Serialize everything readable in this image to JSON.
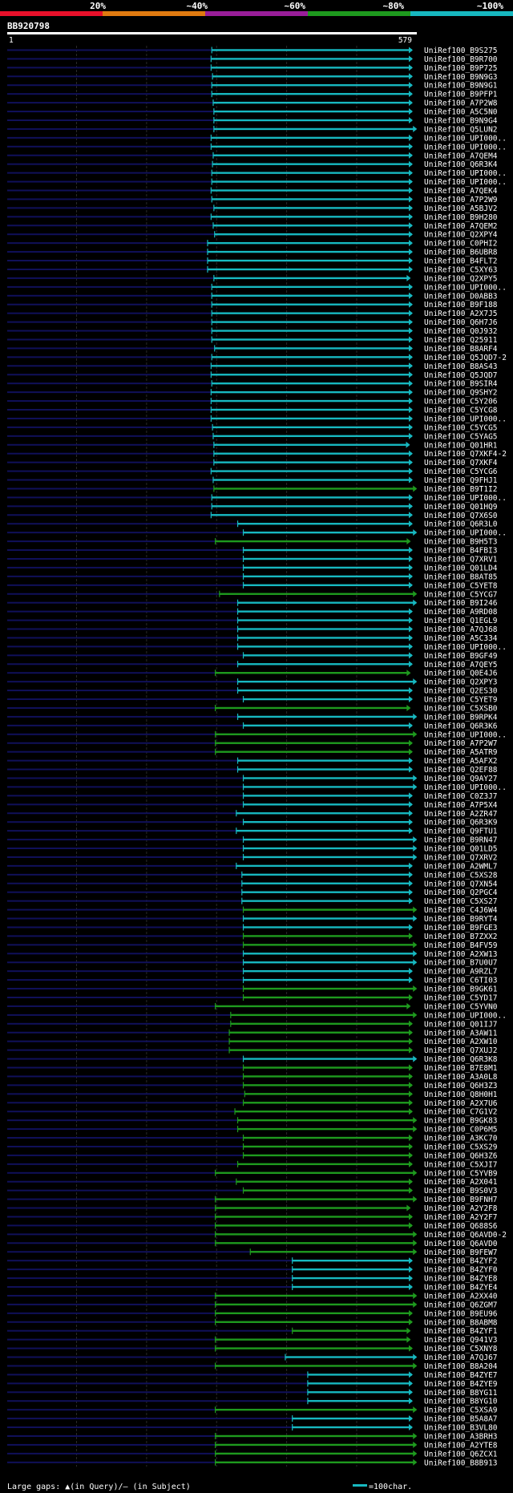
{
  "query_id": "BB920798",
  "identity_legend": [
    {
      "label": "20%",
      "color": "#e8102a"
    },
    {
      "label": "~40%",
      "color": "#e07a10"
    },
    {
      "label": "~60%",
      "color": "#9a1e9a"
    },
    {
      "label": "~80%",
      "color": "#1e9a1e"
    },
    {
      "label": "~100%",
      "color": "#17b8c0"
    }
  ],
  "footer": {
    "gaps_text": "Large gaps: ▲(in Query)/— (in Subject)",
    "scale_text": "=100char."
  },
  "chart_data": {
    "type": "bar",
    "subtype": "blast-alignment-overview",
    "axis": {
      "start": "1",
      "end": "579",
      "min": 1,
      "max": 579
    },
    "grid": true,
    "hits": [
      {
        "name": "UniRef100_B9S275",
        "start": 293,
        "end": 579,
        "identity": 100
      },
      {
        "name": "UniRef100_B9R700",
        "start": 292,
        "end": 579,
        "identity": 100
      },
      {
        "name": "UniRef100_B9P725",
        "start": 292,
        "end": 579,
        "identity": 100
      },
      {
        "name": "UniRef100_B9N9G3",
        "start": 294,
        "end": 579,
        "identity": 100
      },
      {
        "name": "UniRef100_B9N9G1",
        "start": 293,
        "end": 579,
        "identity": 100
      },
      {
        "name": "UniRef100_B9PFP1",
        "start": 293,
        "end": 579,
        "identity": 100
      },
      {
        "name": "UniRef100_A7P2W8",
        "start": 295,
        "end": 579,
        "identity": 100
      },
      {
        "name": "UniRef100_A5C5N0",
        "start": 296,
        "end": 579,
        "identity": 100
      },
      {
        "name": "UniRef100_B9N9G4",
        "start": 296,
        "end": 579,
        "identity": 100
      },
      {
        "name": "UniRef100_Q5LUN2",
        "start": 296,
        "end": 585,
        "identity": 100
      },
      {
        "name": "UniRef100_UPI000..",
        "start": 292,
        "end": 579,
        "identity": 100
      },
      {
        "name": "UniRef100_UPI000..",
        "start": 292,
        "end": 579,
        "identity": 100
      },
      {
        "name": "UniRef100_A7QEM4",
        "start": 295,
        "end": 579,
        "identity": 100
      },
      {
        "name": "UniRef100_Q6R3K4",
        "start": 294,
        "end": 579,
        "identity": 100
      },
      {
        "name": "UniRef100_UPI000..",
        "start": 293,
        "end": 579,
        "identity": 100
      },
      {
        "name": "UniRef100_UPI000..",
        "start": 293,
        "end": 579,
        "identity": 100
      },
      {
        "name": "UniRef100_A7QEK4",
        "start": 292,
        "end": 579,
        "identity": 100
      },
      {
        "name": "UniRef100_A7P2W9",
        "start": 293,
        "end": 579,
        "identity": 100
      },
      {
        "name": "UniRef100_A5BJV2",
        "start": 296,
        "end": 579,
        "identity": 100
      },
      {
        "name": "UniRef100_B9H280",
        "start": 292,
        "end": 579,
        "identity": 100
      },
      {
        "name": "UniRef100_A7QEM2",
        "start": 295,
        "end": 579,
        "identity": 100
      },
      {
        "name": "UniRef100_Q2XPY4",
        "start": 297,
        "end": 579,
        "identity": 100
      },
      {
        "name": "UniRef100_C0PHI2",
        "start": 287,
        "end": 579,
        "identity": 100
      },
      {
        "name": "UniRef100_B6UBR8",
        "start": 287,
        "end": 579,
        "identity": 100
      },
      {
        "name": "UniRef100_B4FLT2",
        "start": 287,
        "end": 579,
        "identity": 100
      },
      {
        "name": "UniRef100_C5XY63",
        "start": 287,
        "end": 579,
        "identity": 100
      },
      {
        "name": "UniRef100_Q2XPY5",
        "start": 296,
        "end": 576,
        "identity": 100
      },
      {
        "name": "UniRef100_UPI000..",
        "start": 293,
        "end": 579,
        "identity": 100
      },
      {
        "name": "UniRef100_D0ABB3",
        "start": 293,
        "end": 579,
        "identity": 100
      },
      {
        "name": "UniRef100_B9F188",
        "start": 293,
        "end": 579,
        "identity": 100
      },
      {
        "name": "UniRef100_A2X7J5",
        "start": 293,
        "end": 579,
        "identity": 100
      },
      {
        "name": "UniRef100_Q6H7J6",
        "start": 293,
        "end": 579,
        "identity": 100
      },
      {
        "name": "UniRef100_Q0J932",
        "start": 293,
        "end": 579,
        "identity": 100
      },
      {
        "name": "UniRef100_Q25911",
        "start": 293,
        "end": 579,
        "identity": 100
      },
      {
        "name": "UniRef100_B8ARF4",
        "start": 297,
        "end": 579,
        "identity": 100
      },
      {
        "name": "UniRef100_Q5JQD7-2",
        "start": 293,
        "end": 579,
        "identity": 100
      },
      {
        "name": "UniRef100_B8AS43",
        "start": 292,
        "end": 579,
        "identity": 100
      },
      {
        "name": "UniRef100_Q5JQD7",
        "start": 292,
        "end": 579,
        "identity": 100
      },
      {
        "name": "UniRef100_B9SIR4",
        "start": 293,
        "end": 579,
        "identity": 100
      },
      {
        "name": "UniRef100_Q9SHY2",
        "start": 292,
        "end": 579,
        "identity": 100
      },
      {
        "name": "UniRef100_C5Y206",
        "start": 292,
        "end": 579,
        "identity": 100
      },
      {
        "name": "UniRef100_C5YCG8",
        "start": 292,
        "end": 579,
        "identity": 100
      },
      {
        "name": "UniRef100_UPI000..",
        "start": 292,
        "end": 579,
        "identity": 100
      },
      {
        "name": "UniRef100_C5YCG5",
        "start": 294,
        "end": 579,
        "identity": 100
      },
      {
        "name": "UniRef100_C5YAG5",
        "start": 295,
        "end": 579,
        "identity": 100
      },
      {
        "name": "UniRef100_Q01HR1",
        "start": 296,
        "end": 575,
        "identity": 100
      },
      {
        "name": "UniRef100_Q7XKF4-2",
        "start": 296,
        "end": 579,
        "identity": 100
      },
      {
        "name": "UniRef100_Q7XKF4",
        "start": 296,
        "end": 579,
        "identity": 100
      },
      {
        "name": "UniRef100_C5YCG6",
        "start": 292,
        "end": 579,
        "identity": 100
      },
      {
        "name": "UniRef100_Q9FHJ1",
        "start": 295,
        "end": 579,
        "identity": 100
      },
      {
        "name": "UniRef100_B9T1I2",
        "start": 296,
        "end": 585,
        "identity": 80
      },
      {
        "name": "UniRef100_UPI000..",
        "start": 293,
        "end": 579,
        "identity": 100
      },
      {
        "name": "UniRef100_Q01HQ9",
        "start": 293,
        "end": 579,
        "identity": 100
      },
      {
        "name": "UniRef100_Q7X6S0",
        "start": 292,
        "end": 579,
        "identity": 100
      },
      {
        "name": "UniRef100_Q6R3L0",
        "start": 330,
        "end": 579,
        "identity": 100
      },
      {
        "name": "UniRef100_UPI000..",
        "start": 338,
        "end": 585,
        "identity": 100
      },
      {
        "name": "UniRef100_B9H5T3",
        "start": 298,
        "end": 576,
        "identity": 80
      },
      {
        "name": "UniRef100_B4FBI3",
        "start": 338,
        "end": 579,
        "identity": 100
      },
      {
        "name": "UniRef100_Q7XRV1",
        "start": 338,
        "end": 579,
        "identity": 100
      },
      {
        "name": "UniRef100_Q01LD4",
        "start": 338,
        "end": 579,
        "identity": 100
      },
      {
        "name": "UniRef100_B8AT85",
        "start": 338,
        "end": 579,
        "identity": 100
      },
      {
        "name": "UniRef100_C5YET8",
        "start": 338,
        "end": 579,
        "identity": 100
      },
      {
        "name": "UniRef100_C5YCG7",
        "start": 304,
        "end": 585,
        "identity": 80
      },
      {
        "name": "UniRef100_B9I246",
        "start": 330,
        "end": 585,
        "identity": 100
      },
      {
        "name": "UniRef100_A9RD08",
        "start": 330,
        "end": 579,
        "identity": 100
      },
      {
        "name": "UniRef100_Q1EGL9",
        "start": 330,
        "end": 579,
        "identity": 100
      },
      {
        "name": "UniRef100_A7QJ68",
        "start": 330,
        "end": 579,
        "identity": 100
      },
      {
        "name": "UniRef100_A5C334",
        "start": 330,
        "end": 579,
        "identity": 100
      },
      {
        "name": "UniRef100_UPI000..",
        "start": 330,
        "end": 579,
        "identity": 100
      },
      {
        "name": "UniRef100_B9GF49",
        "start": 338,
        "end": 579,
        "identity": 100
      },
      {
        "name": "UniRef100_A7QEY5",
        "start": 330,
        "end": 579,
        "identity": 100
      },
      {
        "name": "UniRef100_Q0E4J6",
        "start": 298,
        "end": 576,
        "identity": 80
      },
      {
        "name": "UniRef100_Q2XPY3",
        "start": 330,
        "end": 585,
        "identity": 100
      },
      {
        "name": "UniRef100_Q2ES30",
        "start": 330,
        "end": 579,
        "identity": 100
      },
      {
        "name": "UniRef100_C5YET9",
        "start": 338,
        "end": 579,
        "identity": 100
      },
      {
        "name": "UniRef100_C5XSB0",
        "start": 298,
        "end": 576,
        "identity": 80
      },
      {
        "name": "UniRef100_B9RPK4",
        "start": 330,
        "end": 585,
        "identity": 100
      },
      {
        "name": "UniRef100_Q6R3K6",
        "start": 338,
        "end": 579,
        "identity": 100
      },
      {
        "name": "UniRef100_UPI000..",
        "start": 298,
        "end": 585,
        "identity": 80
      },
      {
        "name": "UniRef100_A7P2W7",
        "start": 298,
        "end": 579,
        "identity": 80
      },
      {
        "name": "UniRef100_A5ATR9",
        "start": 298,
        "end": 579,
        "identity": 80
      },
      {
        "name": "UniRef100_A5AFX2",
        "start": 330,
        "end": 579,
        "identity": 100
      },
      {
        "name": "UniRef100_Q2EF88",
        "start": 330,
        "end": 579,
        "identity": 100
      },
      {
        "name": "UniRef100_Q9AY27",
        "start": 338,
        "end": 585,
        "identity": 100
      },
      {
        "name": "UniRef100_UPI000..",
        "start": 338,
        "end": 585,
        "identity": 100
      },
      {
        "name": "UniRef100_C0Z3J7",
        "start": 338,
        "end": 579,
        "identity": 100
      },
      {
        "name": "UniRef100_A7P5X4",
        "start": 338,
        "end": 579,
        "identity": 100
      },
      {
        "name": "UniRef100_A2ZR47",
        "start": 328,
        "end": 579,
        "identity": 100
      },
      {
        "name": "UniRef100_Q6R3K9",
        "start": 338,
        "end": 579,
        "identity": 100
      },
      {
        "name": "UniRef100_Q9FTU1",
        "start": 328,
        "end": 579,
        "identity": 100
      },
      {
        "name": "UniRef100_B9RN47",
        "start": 338,
        "end": 585,
        "identity": 100
      },
      {
        "name": "UniRef100_Q01LD5",
        "start": 338,
        "end": 585,
        "identity": 100
      },
      {
        "name": "UniRef100_Q7XRV2",
        "start": 338,
        "end": 585,
        "identity": 100
      },
      {
        "name": "UniRef100_A2WML7",
        "start": 328,
        "end": 579,
        "identity": 100
      },
      {
        "name": "UniRef100_C5XS28",
        "start": 336,
        "end": 579,
        "identity": 100
      },
      {
        "name": "UniRef100_Q7XN54",
        "start": 336,
        "end": 579,
        "identity": 100
      },
      {
        "name": "UniRef100_Q2PGC4",
        "start": 336,
        "end": 579,
        "identity": 100
      },
      {
        "name": "UniRef100_C5XS27",
        "start": 336,
        "end": 579,
        "identity": 100
      },
      {
        "name": "UniRef100_C4J6W4",
        "start": 338,
        "end": 585,
        "identity": 80
      },
      {
        "name": "UniRef100_B9RYT4",
        "start": 338,
        "end": 585,
        "identity": 100
      },
      {
        "name": "UniRef100_B9FGE3",
        "start": 338,
        "end": 579,
        "identity": 100
      },
      {
        "name": "UniRef100_B7ZXX2",
        "start": 338,
        "end": 579,
        "identity": 80
      },
      {
        "name": "UniRef100_B4FV59",
        "start": 338,
        "end": 585,
        "identity": 80
      },
      {
        "name": "UniRef100_A2XW13",
        "start": 338,
        "end": 585,
        "identity": 100
      },
      {
        "name": "UniRef100_B7U0U7",
        "start": 338,
        "end": 585,
        "identity": 100
      },
      {
        "name": "UniRef100_A9RZL7",
        "start": 338,
        "end": 579,
        "identity": 100
      },
      {
        "name": "UniRef100_C6TI03",
        "start": 338,
        "end": 579,
        "identity": 100
      },
      {
        "name": "UniRef100_B9GK61",
        "start": 338,
        "end": 585,
        "identity": 80
      },
      {
        "name": "UniRef100_C5YD17",
        "start": 338,
        "end": 579,
        "identity": 80
      },
      {
        "name": "UniRef100_C5YVN0",
        "start": 298,
        "end": 576,
        "identity": 80
      },
      {
        "name": "UniRef100_UPI000..",
        "start": 320,
        "end": 585,
        "identity": 80
      },
      {
        "name": "UniRef100_Q01IJ7",
        "start": 320,
        "end": 579,
        "identity": 80
      },
      {
        "name": "UniRef100_A3AW11",
        "start": 318,
        "end": 579,
        "identity": 80
      },
      {
        "name": "UniRef100_A2XW10",
        "start": 318,
        "end": 579,
        "identity": 80
      },
      {
        "name": "UniRef100_Q7XUJ2",
        "start": 318,
        "end": 579,
        "identity": 80
      },
      {
        "name": "UniRef100_Q6R3K8",
        "start": 338,
        "end": 585,
        "identity": 100
      },
      {
        "name": "UniRef100_B7E8M1",
        "start": 338,
        "end": 579,
        "identity": 80
      },
      {
        "name": "UniRef100_A3A0L8",
        "start": 338,
        "end": 579,
        "identity": 80
      },
      {
        "name": "UniRef100_Q6H3Z3",
        "start": 338,
        "end": 579,
        "identity": 80
      },
      {
        "name": "UniRef100_Q8H0H1",
        "start": 340,
        "end": 579,
        "identity": 80
      },
      {
        "name": "UniRef100_A2X7U6",
        "start": 338,
        "end": 579,
        "identity": 80
      },
      {
        "name": "UniRef100_C7G1V2",
        "start": 326,
        "end": 579,
        "identity": 80
      },
      {
        "name": "UniRef100_B9GK83",
        "start": 330,
        "end": 585,
        "identity": 80
      },
      {
        "name": "UniRef100_C0P6M5",
        "start": 330,
        "end": 585,
        "identity": 80
      },
      {
        "name": "UniRef100_A3KC70",
        "start": 338,
        "end": 579,
        "identity": 80
      },
      {
        "name": "UniRef100_C5XS29",
        "start": 338,
        "end": 579,
        "identity": 80
      },
      {
        "name": "UniRef100_Q6H3Z6",
        "start": 338,
        "end": 579,
        "identity": 80
      },
      {
        "name": "UniRef100_C5XJI7",
        "start": 330,
        "end": 579,
        "identity": 80
      },
      {
        "name": "UniRef100_C5YVB9",
        "start": 298,
        "end": 585,
        "identity": 80
      },
      {
        "name": "UniRef100_A2X041",
        "start": 328,
        "end": 579,
        "identity": 80
      },
      {
        "name": "UniRef100_B9S0V3",
        "start": 338,
        "end": 579,
        "identity": 80
      },
      {
        "name": "UniRef100_B9FNH7",
        "start": 298,
        "end": 585,
        "identity": 80
      },
      {
        "name": "UniRef100_A2Y2F8",
        "start": 298,
        "end": 576,
        "identity": 80
      },
      {
        "name": "UniRef100_A2Y2F7",
        "start": 298,
        "end": 579,
        "identity": 80
      },
      {
        "name": "UniRef100_Q688S6",
        "start": 298,
        "end": 579,
        "identity": 80
      },
      {
        "name": "UniRef100_Q6AVD0-2",
        "start": 298,
        "end": 585,
        "identity": 80
      },
      {
        "name": "UniRef100_Q6AVD0",
        "start": 298,
        "end": 585,
        "identity": 80
      },
      {
        "name": "UniRef100_B9FEW7",
        "start": 348,
        "end": 585,
        "identity": 80
      },
      {
        "name": "UniRef100_B4ZYF2",
        "start": 408,
        "end": 579,
        "identity": 100
      },
      {
        "name": "UniRef100_B4ZYF0",
        "start": 408,
        "end": 579,
        "identity": 100
      },
      {
        "name": "UniRef100_B4ZYE8",
        "start": 408,
        "end": 579,
        "identity": 100
      },
      {
        "name": "UniRef100_B4ZYE4",
        "start": 408,
        "end": 579,
        "identity": 100
      },
      {
        "name": "UniRef100_A2XX40",
        "start": 298,
        "end": 585,
        "identity": 80
      },
      {
        "name": "UniRef100_Q6ZGM7",
        "start": 298,
        "end": 585,
        "identity": 80
      },
      {
        "name": "UniRef100_B9EU96",
        "start": 298,
        "end": 579,
        "identity": 80
      },
      {
        "name": "UniRef100_B8ABM8",
        "start": 298,
        "end": 579,
        "identity": 80
      },
      {
        "name": "UniRef100_B4ZYF1",
        "start": 408,
        "end": 576,
        "identity": 80
      },
      {
        "name": "UniRef100_Q941V3",
        "start": 298,
        "end": 576,
        "identity": 80
      },
      {
        "name": "UniRef100_C5XNY8",
        "start": 298,
        "end": 579,
        "identity": 80
      },
      {
        "name": "UniRef100_A7QJ67",
        "start": 398,
        "end": 585,
        "identity": 100
      },
      {
        "name": "UniRef100_B8A204",
        "start": 298,
        "end": 585,
        "identity": 80
      },
      {
        "name": "UniRef100_B4ZYE7",
        "start": 430,
        "end": 579,
        "identity": 100
      },
      {
        "name": "UniRef100_B4ZYE9",
        "start": 430,
        "end": 579,
        "identity": 100
      },
      {
        "name": "UniRef100_B8YG11",
        "start": 430,
        "end": 579,
        "identity": 100
      },
      {
        "name": "UniRef100_B8YG10",
        "start": 430,
        "end": 579,
        "identity": 100
      },
      {
        "name": "UniRef100_C5XSA9",
        "start": 298,
        "end": 585,
        "identity": 80
      },
      {
        "name": "UniRef100_B5A8A7",
        "start": 408,
        "end": 579,
        "identity": 100
      },
      {
        "name": "UniRef100_B3VL80",
        "start": 408,
        "end": 579,
        "identity": 100
      },
      {
        "name": "UniRef100_A3BRH3",
        "start": 298,
        "end": 585,
        "identity": 80
      },
      {
        "name": "UniRef100_A2YTE8",
        "start": 298,
        "end": 585,
        "identity": 80
      },
      {
        "name": "UniRef100_Q6ZCX1",
        "start": 298,
        "end": 585,
        "identity": 80
      },
      {
        "name": "UniRef100_B8B913",
        "start": 298,
        "end": 585,
        "identity": 80
      }
    ]
  }
}
